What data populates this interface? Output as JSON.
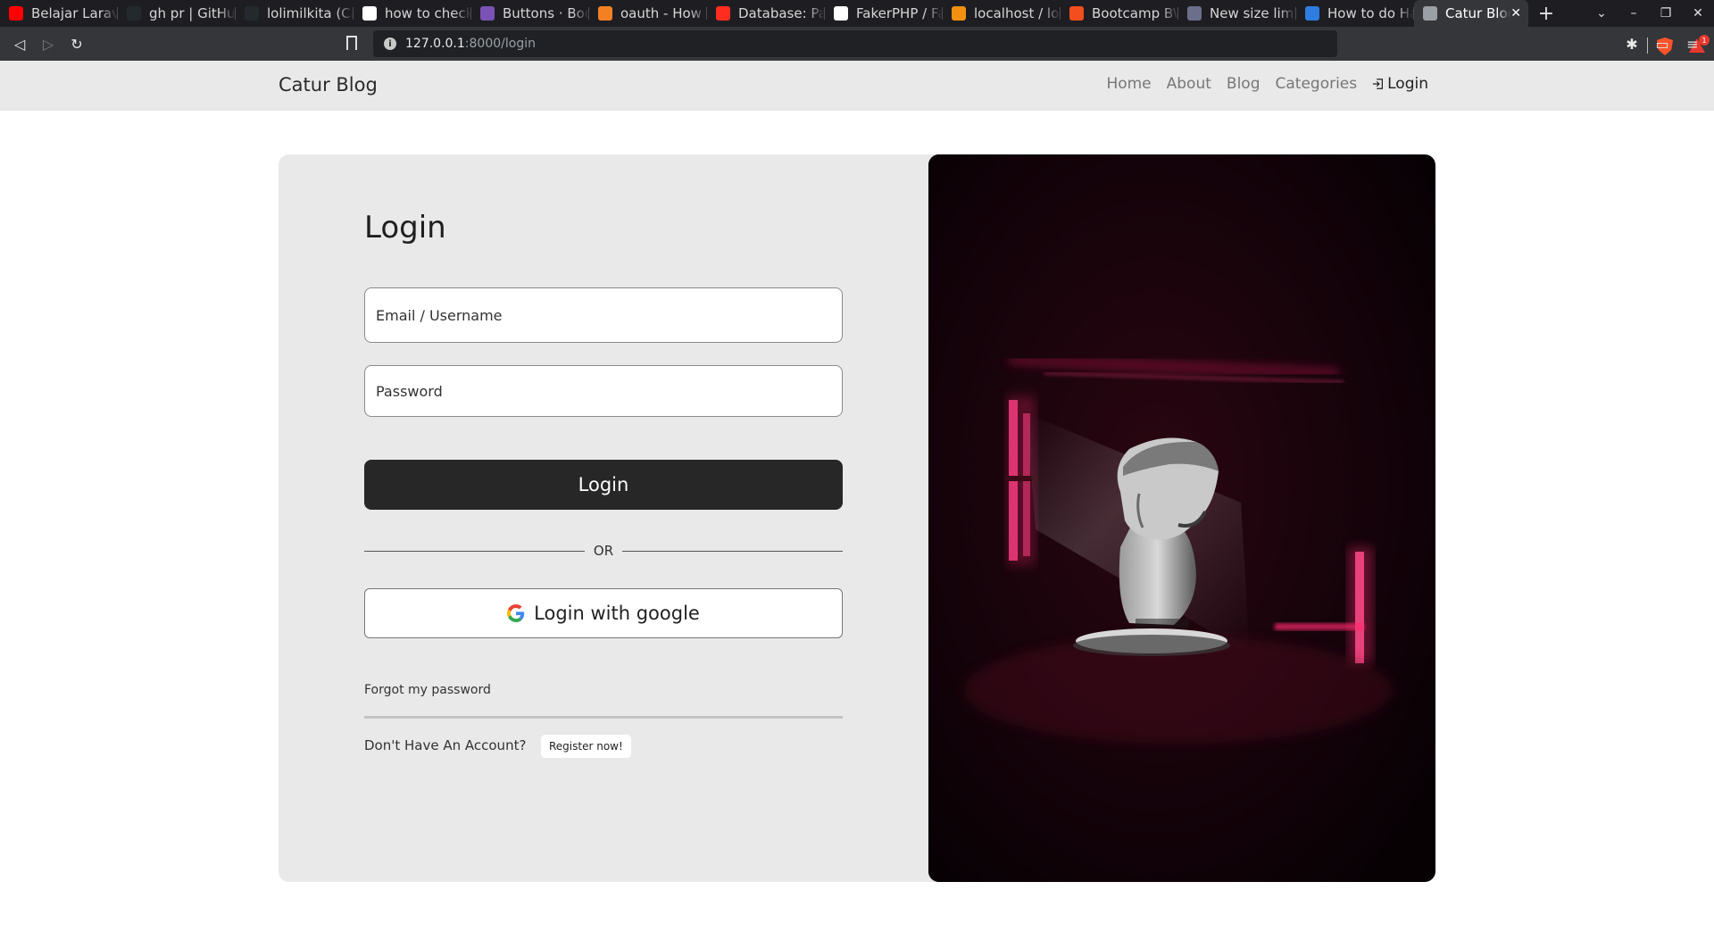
{
  "browser": {
    "tabs": [
      {
        "title": "Belajar Laravel",
        "icon": "youtube-icon",
        "color": "#ff0000"
      },
      {
        "title": "gh pr | GitHub",
        "icon": "github-icon",
        "color": "#24292e"
      },
      {
        "title": "lolimilkita (Ca",
        "icon": "github-icon",
        "color": "#24292e"
      },
      {
        "title": "how to check",
        "icon": "google-icon",
        "color": "#ffffff"
      },
      {
        "title": "Buttons · Boo",
        "icon": "bootstrap-icon",
        "color": "#7952b3"
      },
      {
        "title": "oauth - How t",
        "icon": "stackoverflow-icon",
        "color": "#f48024"
      },
      {
        "title": "Database: Pag",
        "icon": "laravel-icon",
        "color": "#ff2d20"
      },
      {
        "title": "FakerPHP / Fa",
        "icon": "faker-icon",
        "color": "#ffffff"
      },
      {
        "title": "localhost / loc",
        "icon": "phpmyadmin-icon",
        "color": "#f29111"
      },
      {
        "title": "Bootcamp BW",
        "icon": "figma-icon",
        "color": "#f24e1e"
      },
      {
        "title": "New size limit",
        "icon": "nu-icon",
        "color": "#6b6f8a"
      },
      {
        "title": "How to do Ha",
        "icon": "doc-icon",
        "color": "#2f7de1"
      },
      {
        "title": "Catur Blog",
        "icon": "globe-icon",
        "color": "#9aa0a6",
        "active": true
      }
    ],
    "url_host": "127.0.0.1",
    "url_path": ":8000/login"
  },
  "navbar": {
    "brand": "Catur Blog",
    "links": [
      "Home",
      "About",
      "Blog",
      "Categories"
    ],
    "login": "Login"
  },
  "form": {
    "title": "Login",
    "email_placeholder": "Email / Username",
    "password_placeholder": "Password",
    "login_button": "Login",
    "divider": "OR",
    "google_button": "Login with google",
    "forgot": "Forgot my password",
    "no_account": "Don't Have An Account?",
    "register_button": "Register now!"
  },
  "colors": {
    "card_bg": "#e9e9e9",
    "button_dark": "#272727",
    "accent_neon": "#ff1f6a"
  }
}
